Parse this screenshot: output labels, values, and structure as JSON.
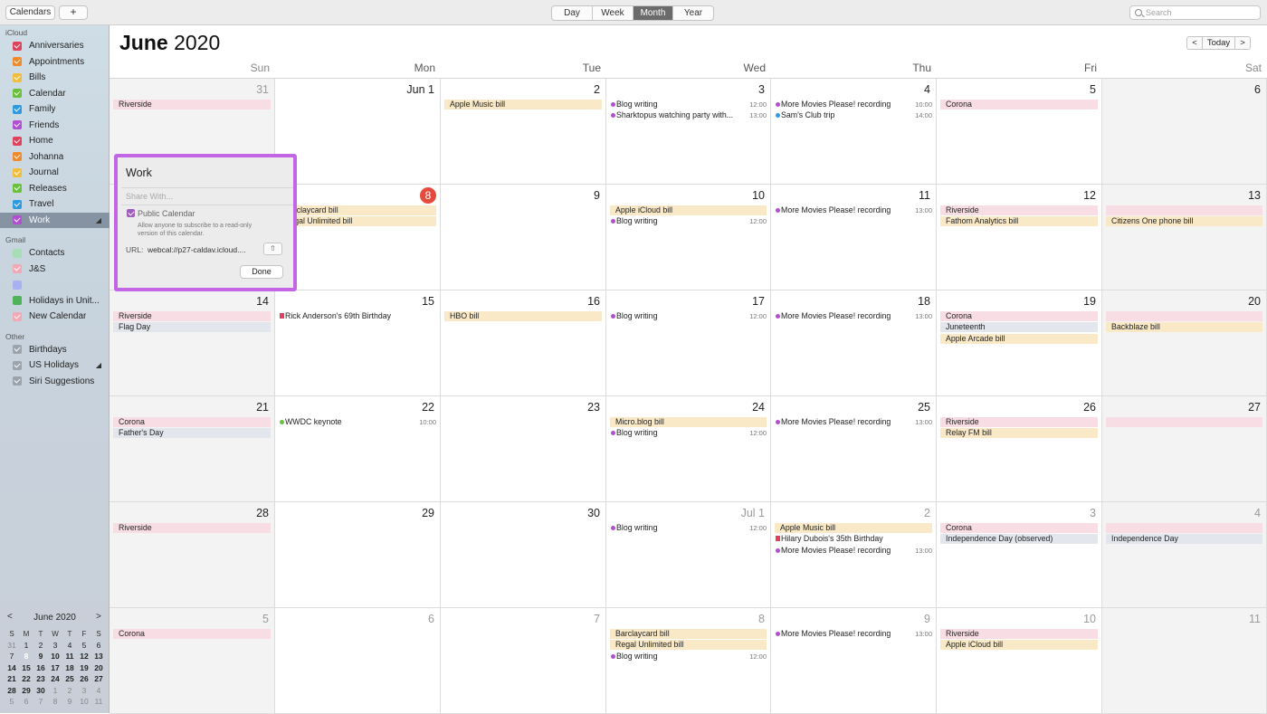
{
  "toolbar": {
    "calendars_label": "Calendars",
    "add_label": "+",
    "views": [
      "Day",
      "Week",
      "Month",
      "Year"
    ],
    "selected_view": "Month",
    "search_placeholder": "Search"
  },
  "sidebar": {
    "groups": [
      {
        "name": "iCloud",
        "items": [
          {
            "label": "Anniversaries",
            "color": "#e0405a",
            "checked": true
          },
          {
            "label": "Appointments",
            "color": "#f0892a",
            "checked": true
          },
          {
            "label": "Bills",
            "color": "#f2bd3b",
            "checked": true
          },
          {
            "label": "Calendar",
            "color": "#67c23a",
            "checked": true
          },
          {
            "label": "Family",
            "color": "#2f9ae0",
            "checked": true
          },
          {
            "label": "Friends",
            "color": "#b24fd0",
            "checked": true
          },
          {
            "label": "Home",
            "color": "#e0405a",
            "checked": true
          },
          {
            "label": "Johanna",
            "color": "#f0892a",
            "checked": true
          },
          {
            "label": "Journal",
            "color": "#f2bd3b",
            "checked": true
          },
          {
            "label": "Releases",
            "color": "#67c23a",
            "checked": true
          },
          {
            "label": "Travel",
            "color": "#2f9ae0",
            "checked": true
          },
          {
            "label": "Work",
            "color": "#b24fd0",
            "checked": true,
            "selected": true,
            "shared": true
          }
        ]
      },
      {
        "name": "Gmail",
        "items": [
          {
            "label": "Contacts",
            "color": "#a8ddb8",
            "checked": false
          },
          {
            "label": "J&S",
            "color": "#f2a9b6",
            "checked": true
          },
          {
            "label": "",
            "color": "#a9b2f0",
            "checked": false
          },
          {
            "label": "Holidays in Unit...",
            "color": "#4fb35a",
            "checked": false
          },
          {
            "label": "New Calendar",
            "color": "#f2a9b6",
            "checked": true
          }
        ]
      },
      {
        "name": "Other",
        "items": [
          {
            "label": "Birthdays",
            "color": "#9aa3ae",
            "checked": true
          },
          {
            "label": "US Holidays",
            "color": "#9aa3ae",
            "checked": true,
            "shared": true
          },
          {
            "label": "Siri Suggestions",
            "color": "#9aa3ae",
            "checked": true
          }
        ]
      }
    ]
  },
  "mini_calendar": {
    "title": "June 2020",
    "prev": "<",
    "next": ">",
    "weekdays": [
      "S",
      "M",
      "T",
      "W",
      "T",
      "F",
      "S"
    ],
    "weeks": [
      [
        "31",
        "1",
        "2",
        "3",
        "4",
        "5",
        "6"
      ],
      [
        "7",
        "8",
        "9",
        "10",
        "11",
        "12",
        "13"
      ],
      [
        "14",
        "15",
        "16",
        "17",
        "18",
        "19",
        "20"
      ],
      [
        "21",
        "22",
        "23",
        "24",
        "25",
        "26",
        "27"
      ],
      [
        "28",
        "29",
        "30",
        "1",
        "2",
        "3",
        "4"
      ],
      [
        "5",
        "6",
        "7",
        "8",
        "9",
        "10",
        "11"
      ]
    ]
  },
  "main": {
    "month_bold": "June",
    "year": "2020",
    "nav": {
      "prev": "<",
      "today": "Today",
      "next": ">"
    },
    "weekdays": [
      "Sun",
      "Mon",
      "Tue",
      "Wed",
      "Thu",
      "Fri",
      "Sat"
    ]
  },
  "weeks": [
    [
      {
        "day": "31",
        "dim": true,
        "events": [
          {
            "t": "Riverside",
            "k": "pink"
          }
        ]
      },
      {
        "day": "Jun 1",
        "events": []
      },
      {
        "day": "2",
        "events": [
          {
            "t": "Apple Music bill",
            "k": "yellow"
          }
        ]
      },
      {
        "day": "3",
        "events": [
          {
            "t": "Blog writing",
            "k": "dot",
            "c": "#b24fd0",
            "time": "12:00"
          },
          {
            "t": "Sharktopus watching party with...",
            "k": "dot",
            "c": "#b24fd0",
            "time": "13:00"
          }
        ]
      },
      {
        "day": "4",
        "events": [
          {
            "t": "More Movies Please! recording",
            "k": "dot",
            "c": "#b24fd0",
            "time": "10:00"
          },
          {
            "t": "Sam's Club trip",
            "k": "dot",
            "c": "#2f9ae0",
            "time": "14:00"
          }
        ]
      },
      {
        "day": "5",
        "events": [
          {
            "t": "Corona",
            "k": "pink"
          }
        ]
      },
      {
        "day": "6",
        "events": []
      }
    ],
    [
      {
        "day": "7",
        "events": []
      },
      {
        "day": "8",
        "today": true,
        "events": [
          {
            "t": "Barclaycard bill",
            "k": "yellow"
          },
          {
            "t": "Regal Unlimited bill",
            "k": "yellow"
          }
        ]
      },
      {
        "day": "9",
        "events": []
      },
      {
        "day": "10",
        "events": [
          {
            "t": "Apple iCloud bill",
            "k": "yellow"
          },
          {
            "t": "Blog writing",
            "k": "dot",
            "c": "#b24fd0",
            "time": "12:00"
          }
        ]
      },
      {
        "day": "11",
        "events": [
          {
            "t": "More Movies Please! recording",
            "k": "dot",
            "c": "#b24fd0",
            "time": "13:00"
          }
        ]
      },
      {
        "day": "12",
        "events": [
          {
            "t": "Riverside",
            "k": "pink"
          },
          {
            "t": "Fathom Analytics bill",
            "k": "yellow"
          }
        ]
      },
      {
        "day": "13",
        "events": [
          {
            "t": "",
            "k": "pink"
          },
          {
            "t": "Citizens One phone bill",
            "k": "yellow"
          }
        ]
      }
    ],
    [
      {
        "day": "14",
        "events": [
          {
            "t": "Riverside",
            "k": "pink"
          },
          {
            "t": "Flag Day",
            "k": "gray"
          }
        ]
      },
      {
        "day": "15",
        "events": [
          {
            "t": "Rick Anderson's 69th Birthday",
            "k": "gift"
          }
        ]
      },
      {
        "day": "16",
        "events": [
          {
            "t": "HBO bill",
            "k": "yellow"
          }
        ]
      },
      {
        "day": "17",
        "events": [
          {
            "t": "Blog writing",
            "k": "dot",
            "c": "#b24fd0",
            "time": "12:00"
          }
        ]
      },
      {
        "day": "18",
        "events": [
          {
            "t": "More Movies Please! recording",
            "k": "dot",
            "c": "#b24fd0",
            "time": "13:00"
          }
        ]
      },
      {
        "day": "19",
        "events": [
          {
            "t": "Corona",
            "k": "pink"
          },
          {
            "t": "Juneteenth",
            "k": "gray"
          },
          {
            "t": "Apple Arcade bill",
            "k": "yellow"
          }
        ]
      },
      {
        "day": "20",
        "events": [
          {
            "t": "",
            "k": "pink"
          },
          {
            "t": "Backblaze bill",
            "k": "yellow"
          }
        ]
      }
    ],
    [
      {
        "day": "21",
        "events": [
          {
            "t": "Corona",
            "k": "pink"
          },
          {
            "t": "Father's Day",
            "k": "gray"
          }
        ]
      },
      {
        "day": "22",
        "events": [
          {
            "t": "WWDC keynote",
            "k": "dot",
            "c": "#67c23a",
            "time": "10:00"
          }
        ]
      },
      {
        "day": "23",
        "events": []
      },
      {
        "day": "24",
        "events": [
          {
            "t": "Micro.blog bill",
            "k": "yellow"
          },
          {
            "t": "Blog writing",
            "k": "dot",
            "c": "#b24fd0",
            "time": "12:00"
          }
        ]
      },
      {
        "day": "25",
        "events": [
          {
            "t": "More Movies Please! recording",
            "k": "dot",
            "c": "#b24fd0",
            "time": "13:00"
          }
        ]
      },
      {
        "day": "26",
        "events": [
          {
            "t": "Riverside",
            "k": "pink"
          },
          {
            "t": "Relay FM bill",
            "k": "yellow"
          }
        ]
      },
      {
        "day": "27",
        "events": [
          {
            "t": "",
            "k": "pink"
          }
        ]
      }
    ],
    [
      {
        "day": "28",
        "events": [
          {
            "t": "Riverside",
            "k": "pink"
          }
        ]
      },
      {
        "day": "29",
        "events": []
      },
      {
        "day": "30",
        "events": []
      },
      {
        "day": "Jul 1",
        "dim": true,
        "events": [
          {
            "t": "Blog writing",
            "k": "dot",
            "c": "#b24fd0",
            "time": "12:00"
          }
        ]
      },
      {
        "day": "2",
        "dim": true,
        "events": [
          {
            "t": "Apple Music bill",
            "k": "yellow"
          },
          {
            "t": "Hilary Dubois's 35th Birthday",
            "k": "gift"
          },
          {
            "t": "More Movies Please! recording",
            "k": "dot",
            "c": "#b24fd0",
            "time": "13:00"
          }
        ]
      },
      {
        "day": "3",
        "dim": true,
        "events": [
          {
            "t": "Corona",
            "k": "pink"
          },
          {
            "t": "Independence Day (observed)",
            "k": "gray"
          }
        ]
      },
      {
        "day": "4",
        "dim": true,
        "events": [
          {
            "t": "",
            "k": "pink"
          },
          {
            "t": "Independence Day",
            "k": "gray"
          }
        ]
      }
    ],
    [
      {
        "day": "5",
        "dim": true,
        "events": [
          {
            "t": "Corona",
            "k": "pink"
          }
        ]
      },
      {
        "day": "6",
        "dim": true,
        "events": []
      },
      {
        "day": "7",
        "dim": true,
        "events": []
      },
      {
        "day": "8",
        "dim": true,
        "events": [
          {
            "t": "Barclaycard bill",
            "k": "yellow"
          },
          {
            "t": "Regal Unlimited bill",
            "k": "yellow"
          },
          {
            "t": "Blog writing",
            "k": "dot",
            "c": "#b24fd0",
            "time": "12:00"
          }
        ]
      },
      {
        "day": "9",
        "dim": true,
        "events": [
          {
            "t": "More Movies Please! recording",
            "k": "dot",
            "c": "#b24fd0",
            "time": "13:00"
          }
        ]
      },
      {
        "day": "10",
        "dim": true,
        "events": [
          {
            "t": "Riverside",
            "k": "pink"
          },
          {
            "t": "Apple iCloud bill",
            "k": "yellow"
          }
        ]
      },
      {
        "day": "11",
        "dim": true,
        "events": []
      }
    ]
  ],
  "popover": {
    "title": "Work",
    "share_placeholder": "Share With...",
    "public_label": "Public Calendar",
    "public_checked": true,
    "public_desc": "Allow anyone to subscribe to a read-only version of this calendar.",
    "url_label": "URL:",
    "url_value": "webcal://p27-caldav.icloud....",
    "share_icon": "share-icon",
    "done_label": "Done",
    "accent": "#c266e6"
  }
}
